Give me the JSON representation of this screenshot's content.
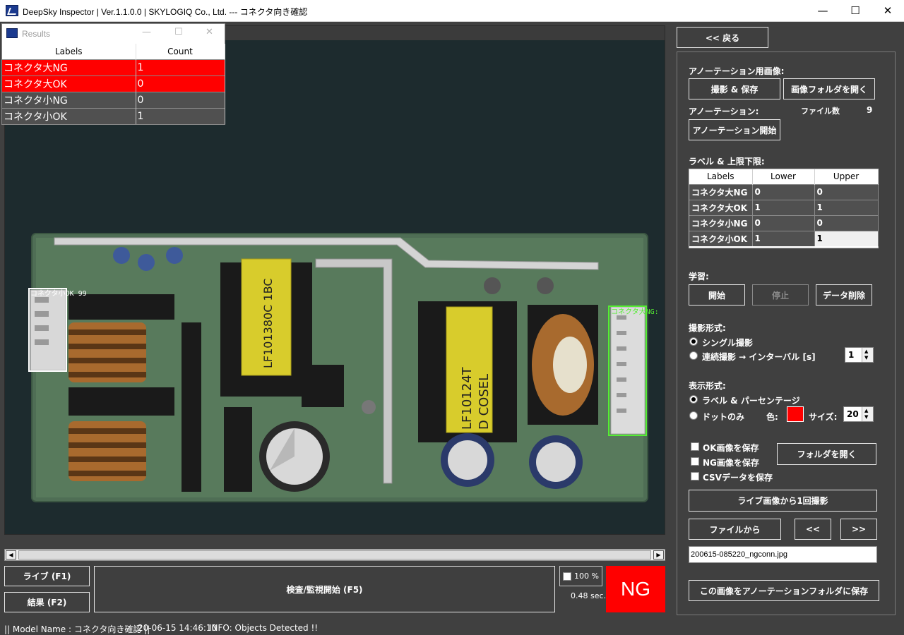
{
  "window": {
    "title": "DeepSky Inspector | Ver.1.1.0.0 | SKYLOGIQ Co., Ltd. --- コネクタ向き確認",
    "minimize": "—",
    "maximize": "☐",
    "close": "✕"
  },
  "results_window": {
    "title": "Results",
    "headers": [
      "Labels",
      "Count"
    ],
    "rows": [
      {
        "label": "コネクタ大NG",
        "count": "1"
      },
      {
        "label": "コネクタ大OK",
        "count": "0"
      },
      {
        "label": "コネクタ小NG",
        "count": "0"
      },
      {
        "label": "コネクタ小OK",
        "count": "1"
      }
    ]
  },
  "viewer": {
    "detections": [
      {
        "label": "コネクタ小OK 99",
        "color": "#ffffff"
      },
      {
        "label": "コネクタ大NG:",
        "color": "#55ee33"
      }
    ]
  },
  "panel": {
    "back_button": "<< 戻る",
    "annotation_images_label": "アノーテーション用画像:",
    "capture_save_button": "撮影 & 保存",
    "open_image_folder_button": "画像フォルダを開く",
    "annotation_label": "アノーテーション:",
    "file_count_label": "ファイル数",
    "file_count_value": "9",
    "start_annotation_button": "アノーテーション開始",
    "label_limits_label": "ラベル & 上限下限:",
    "limits_headers": [
      "Labels",
      "Lower",
      "Upper"
    ],
    "limits_rows": [
      {
        "label": "コネクタ大NG",
        "lower": "0",
        "upper": "0"
      },
      {
        "label": "コネクタ大OK",
        "lower": "1",
        "upper": "1"
      },
      {
        "label": "コネクタ小NG",
        "lower": "0",
        "upper": "0"
      },
      {
        "label": "コネクタ小OK",
        "lower": "1",
        "upper": "1"
      }
    ],
    "learning_label": "学習:",
    "learn_start_button": "開始",
    "learn_stop_button": "停止",
    "delete_data_button": "データ削除",
    "capture_mode_label": "撮影形式:",
    "single_capture": "シングル撮影",
    "continuous_capture": "連続撮影 → インターバル [s]",
    "interval_value": "1",
    "display_mode_label": "表示形式:",
    "label_percentage": "ラベル & パーセンテージ",
    "dots_only": "ドットのみ",
    "color_label": "色:",
    "dot_color": "#ff0000",
    "size_label": "サイズ:",
    "size_value": "20",
    "save_ok_images": "OK画像を保存",
    "save_ng_images": "NG画像を保存",
    "save_csv": "CSVデータを保存",
    "open_folder_button": "フォルダを開く",
    "capture_once_button": "ライブ画像から1回撮影",
    "from_file_button": "ファイルから",
    "prev_button": "<<",
    "next_button": ">>",
    "filename": "200615-085220_ngconn.jpg",
    "save_to_annotation_button": "この画像をアノーテーションフォルダに保存"
  },
  "bottom": {
    "live_button": "ライブ (F1)",
    "result_button": "結果 (F2)",
    "inspect_button": "検査/監視開始 (F5)",
    "zoom_value": "100 %",
    "elapsed": "0.48 sec.",
    "verdict": "NG",
    "verdict_color": "#ff0000"
  },
  "status": {
    "model": "|| Model Name : コネクタ向き確認 ||",
    "timestamp": "20-06-15 14:46:10",
    "info": "INFO:   Objects Detected !!"
  }
}
